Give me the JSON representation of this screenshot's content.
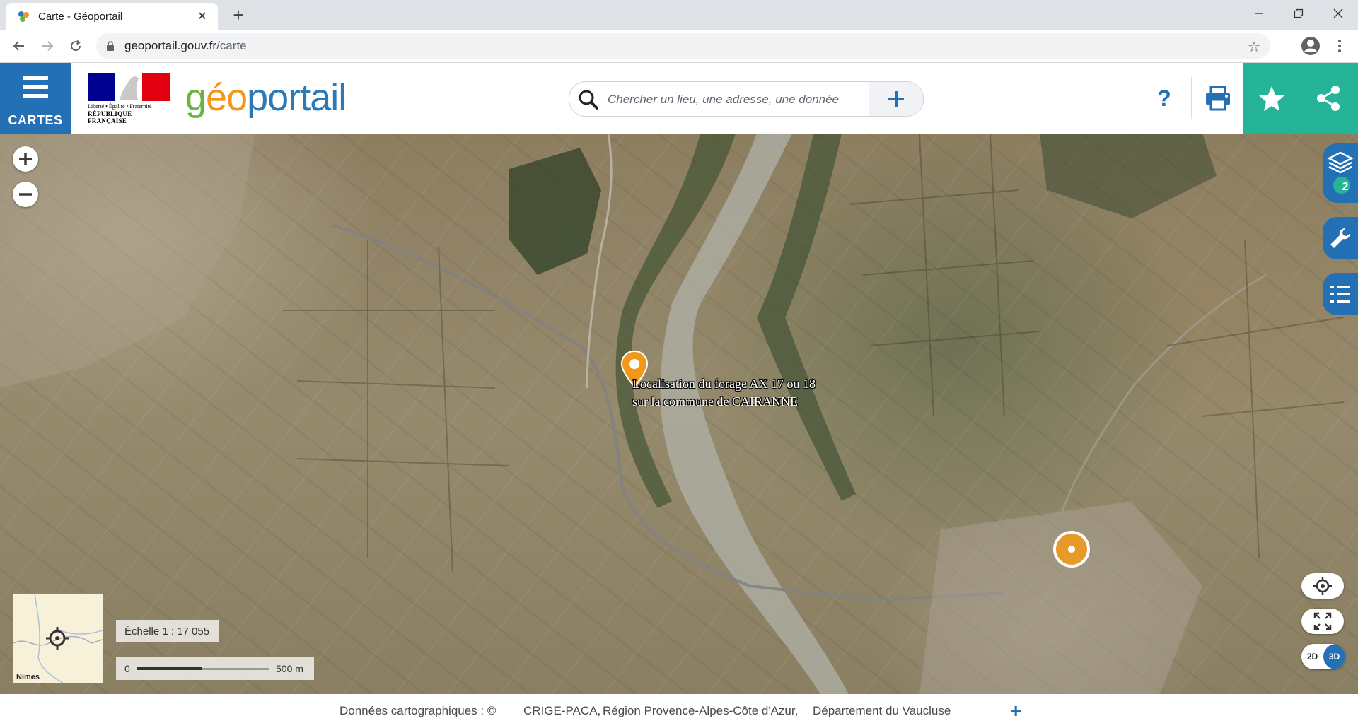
{
  "browser": {
    "tab_title": "Carte - Géoportail",
    "url_host": "geoportail.gouv.fr",
    "url_path": "/carte"
  },
  "header": {
    "menu_label": "CARTES",
    "marianne_motto": "Liberté • Égalité • Fraternité",
    "marianne_name": "RÉPUBLIQUE FRANÇAISE",
    "logo_part1": "g",
    "logo_part2": "é",
    "logo_part3": "o",
    "logo_part4": "portail",
    "search_placeholder": "Chercher un lieu, une adresse, une donnée",
    "help_label": "?"
  },
  "map": {
    "marker_label_line1": "Localisation du forage AX 17 ou 18",
    "marker_label_line2": "sur la commune de CAIRANNE",
    "layers_count": "2",
    "overview_label": "Nimes",
    "scale_text": "Échelle 1 : 17 055",
    "scalebar_zero": "0",
    "scalebar_max": "500 m",
    "toggle_2d": "2D",
    "toggle_3d": "3D"
  },
  "footer": {
    "prefix": "Données cartographiques : ©",
    "source1": "CRIGE-PACA,",
    "source2": "Région Provence-Alpes-Côte d'Azur,",
    "source3": "Département du Vaucluse",
    "more": "+"
  },
  "colors": {
    "primary_blue": "#2370b4",
    "action_green": "#26b499",
    "marker_orange": "#f29718"
  }
}
